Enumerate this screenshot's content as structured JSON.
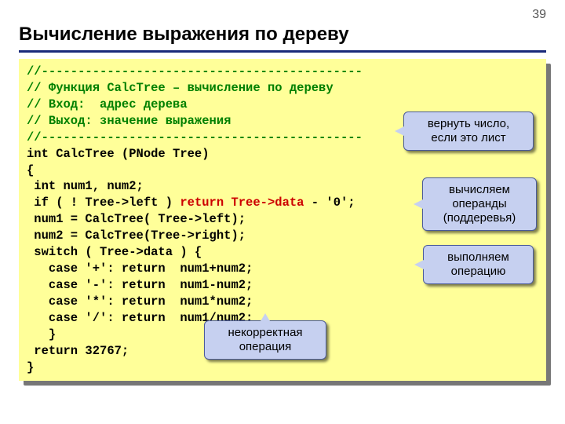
{
  "page_number": "39",
  "title": "Вычисление выражения по дерeву",
  "code": {
    "l1": "//--------------------------------------------",
    "l2": "// Функция CalcTree – вычисление по дереву",
    "l3": "// Вход:  адрес дерева",
    "l4": "// Выход: значение выражения",
    "l5": "//--------------------------------------------",
    "l6": "int CalcTree (PNode Tree)",
    "l7": "{",
    "l8": " int num1, num2;",
    "l9a": " if ( ! Tree->left ) ",
    "l9b": "return Tree->data",
    "l9c": " - '0';",
    "l10": " num1 = CalcTree( Tree->left);",
    "l11": " num2 = CalcTree(Tree->right);",
    "l12": " switch ( Tree->data ) {",
    "l13": "   case '+': return  num1+num2;",
    "l14": "   case '-': return  num1-num2;",
    "l15": "   case '*': return  num1*num2;",
    "l16": "   case '/': return  num1/num2;",
    "l17": "   }",
    "l18": " return 32767;",
    "l19": "}"
  },
  "callouts": {
    "c1": "вернуть число, если это лист",
    "c2": "вычисляем операнды (поддеревья)",
    "c3": "выполняем операцию",
    "c4": "некорректная операция"
  }
}
